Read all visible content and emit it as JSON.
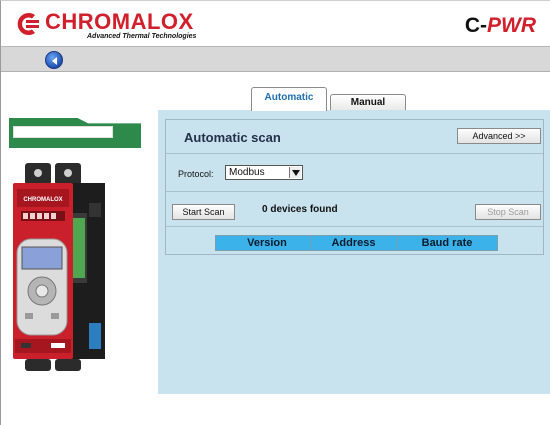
{
  "header": {
    "company": "CHROMALOX",
    "tagline": "Advanced Thermal Technologies",
    "product_prefix": "C-",
    "product_suffix": "PWR",
    "brand_color": "#d11f2b"
  },
  "toolbar": {
    "back_icon": "back-arrow-icon"
  },
  "tabs": [
    {
      "label": "Automatic",
      "active": true
    },
    {
      "label": "Manual",
      "active": false
    }
  ],
  "scan": {
    "title": "Automatic scan",
    "advanced_label": "Advanced >>",
    "protocol_label": "Protocol:",
    "protocol_value": "Modbus",
    "start_label": "Start Scan",
    "found_text": "0 devices found",
    "stop_label": "Stop Scan",
    "columns": [
      "Version",
      "Address",
      "Baud rate"
    ]
  },
  "colors": {
    "content_bg": "#c9e3ee",
    "table_header": "#3bb3ea",
    "tag_green": "#2d8a4a"
  }
}
